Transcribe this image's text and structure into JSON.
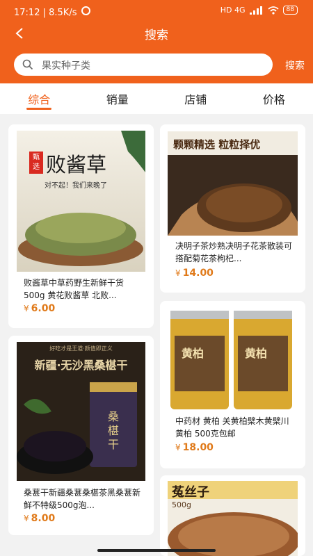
{
  "status_bar": {
    "time": "17:12",
    "speed": "8.5K/s",
    "network": "HD 4G",
    "battery": "88"
  },
  "header": {
    "title": "搜索"
  },
  "search": {
    "placeholder": "果实种子类",
    "button_label": "搜索"
  },
  "tabs": [
    {
      "label": "综合",
      "active": true
    },
    {
      "label": "销量",
      "active": false
    },
    {
      "label": "店铺",
      "active": false
    },
    {
      "label": "价格",
      "active": false
    }
  ],
  "products": [
    {
      "name": "败酱草中草药野生新鲜干货500g 黄花败酱草 北败...",
      "currency": "¥",
      "price": "6.00",
      "image_text": {
        "badge": [
          "甄",
          "选"
        ],
        "title": "败酱草",
        "slogan": "对不起！我们来晚了"
      }
    },
    {
      "name": "决明子茶炒熟决明子花茶散装可搭配菊花茶枸杞...",
      "currency": "¥",
      "price": "14.00",
      "image_text": {
        "title": "颗颗精选 粒粒择优"
      }
    },
    {
      "name": "桑葚干新疆桑葚桑椹茶黑桑葚新鲜不特级500g泡...",
      "currency": "¥",
      "price": "8.00",
      "image_text": {
        "top": "好吃才是王道·颜值即正义",
        "title": "新疆·无沙黑桑椹干",
        "jar": "桑椹干"
      }
    },
    {
      "name": "中药材 黄柏 关黄柏檗木黄檗川黄柏 500克包邮",
      "currency": "¥",
      "price": "18.00",
      "image_text": {
        "jar_left": "黄柏",
        "jar_right": "黄柏"
      }
    },
    {
      "name": "",
      "currency": "",
      "price": "",
      "image_text": {
        "title": "菟丝子",
        "weight": "500g"
      }
    }
  ],
  "colors": {
    "accent": "#f0611c",
    "price": "#e07a1a"
  }
}
